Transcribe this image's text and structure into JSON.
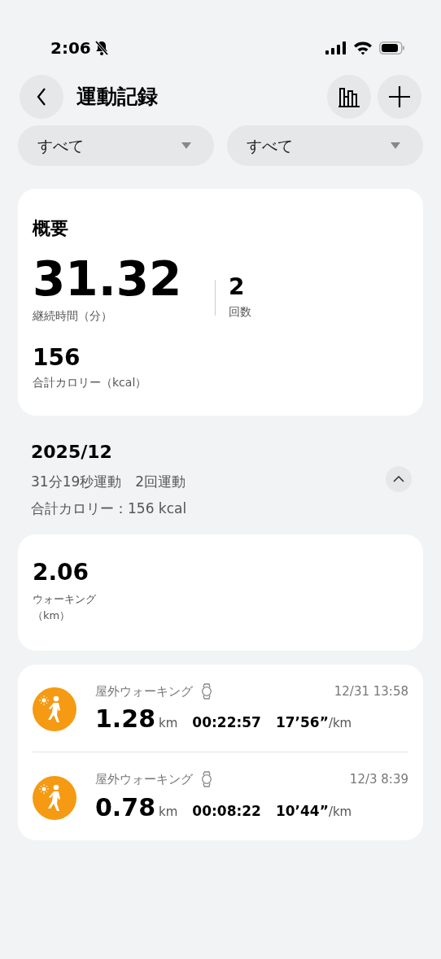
{
  "status_bar": {
    "time": "2:06",
    "silent": true
  },
  "header": {
    "title": "運動記録"
  },
  "filters": [
    {
      "label": "すべて"
    },
    {
      "label": "すべて"
    }
  ],
  "summary": {
    "title": "概要",
    "duration": "31.32",
    "duration_label": "継続時間（分）",
    "count": "2",
    "count_label": "回数",
    "calories": "156",
    "calories_label": "合計カロリー（kcal）"
  },
  "month": {
    "title": "2025/12",
    "stats": "31分19秒運動　2回運動",
    "calories": "合計カロリー：156 kcal",
    "expanded": true
  },
  "distance": {
    "value": "2.06",
    "label": "ウォーキング",
    "unit": "（km）"
  },
  "activities": [
    {
      "name": "屋外ウォーキング",
      "time": "12/31 13:58",
      "distance": "1.28",
      "distance_unit": "km",
      "duration": "00:22:57",
      "pace": "17’56”",
      "pace_unit": "/km"
    },
    {
      "name": "屋外ウォーキング",
      "time": "12/3 8:39",
      "distance": "0.78",
      "distance_unit": "km",
      "duration": "00:08:22",
      "pace": "10’44”",
      "pace_unit": "/km"
    }
  ]
}
